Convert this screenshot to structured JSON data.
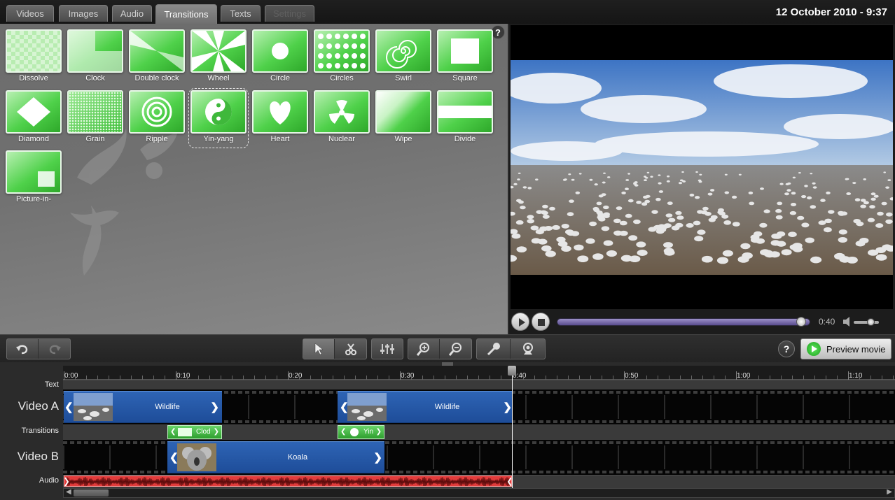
{
  "tabs": [
    {
      "label": "Videos",
      "state": "normal"
    },
    {
      "label": "Images",
      "state": "normal"
    },
    {
      "label": "Audio",
      "state": "normal"
    },
    {
      "label": "Transitions",
      "state": "active"
    },
    {
      "label": "Texts",
      "state": "normal"
    },
    {
      "label": "Settings",
      "state": "disabled"
    }
  ],
  "datetime": "12 October 2010 - 9:37",
  "transitions": {
    "help_label": "?",
    "items": [
      {
        "label": "Dissolve",
        "icon": "dissolve-icon"
      },
      {
        "label": "Clock",
        "icon": "clock-icon"
      },
      {
        "label": "Double clock",
        "icon": "double-clock-icon"
      },
      {
        "label": "Wheel",
        "icon": "wheel-icon"
      },
      {
        "label": "Circle",
        "icon": "circle-icon"
      },
      {
        "label": "Circles",
        "icon": "circles-icon"
      },
      {
        "label": "Swirl",
        "icon": "swirl-icon"
      },
      {
        "label": "Square",
        "icon": "square-icon"
      },
      {
        "label": "Diamond",
        "icon": "diamond-icon"
      },
      {
        "label": "Grain",
        "icon": "grain-icon"
      },
      {
        "label": "Ripple",
        "icon": "ripple-icon"
      },
      {
        "label": "Yin-yang",
        "icon": "yin-yang-icon",
        "selected": true
      },
      {
        "label": "Heart",
        "icon": "heart-icon"
      },
      {
        "label": "Nuclear",
        "icon": "nuclear-icon"
      },
      {
        "label": "Wipe",
        "icon": "wipe-icon"
      },
      {
        "label": "Divide",
        "icon": "divide-icon"
      },
      {
        "label": "Picture-in-",
        "icon": "picture-in-picture-icon"
      }
    ]
  },
  "player": {
    "time": "0:40",
    "progress": 0.985,
    "volume": 0.75
  },
  "toolbar": {
    "help_label": "?",
    "preview_label": "Preview movie"
  },
  "timeline": {
    "ticks": [
      "0:00",
      "0:10",
      "0:20",
      "0:30",
      "0:40",
      "0:50",
      "1:00",
      "1:10"
    ],
    "tracks": {
      "text": "Text",
      "video_a": "Video A",
      "transitions": "Transitions",
      "video_b": "Video B",
      "audio": "Audio"
    },
    "clips": {
      "video_a_1": "Wildlife",
      "video_a_2": "Wildlife",
      "video_b_1": "Koala",
      "transition_1": "Clod",
      "transition_2": "Yin"
    }
  },
  "colors": {
    "clip_blue": "#2457a7",
    "transition_green": "#45b845",
    "audio_red": "#e23b3b",
    "progress_purple": "#7a6db0"
  }
}
